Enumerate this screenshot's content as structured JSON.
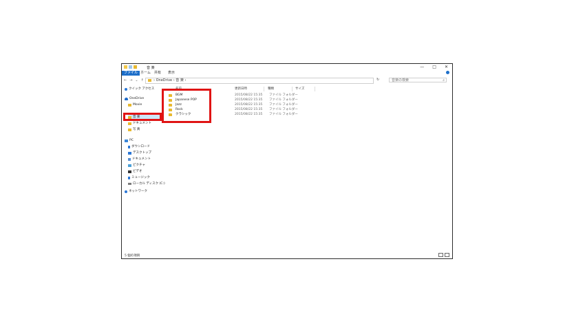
{
  "window": {
    "title": "音 楽",
    "controls": [
      "—",
      "□",
      "✕"
    ]
  },
  "ribbon": {
    "tabs": [
      "ファイル",
      "ホーム",
      "共有",
      "表示"
    ]
  },
  "address_bar": {
    "back": "←",
    "forward": "→",
    "up_history": "⌄",
    "up": "↑",
    "path": "› OneDrive › 音 楽 ›",
    "refresh": "↻",
    "search_placeholder": "音楽の検索",
    "search_icon": "⌕"
  },
  "sidebar": {
    "items": [
      {
        "label": "クイック アクセス",
        "icon": "star-icon",
        "color": "#2b77d6"
      },
      {
        "label": "OneDrive",
        "icon": "cloud-icon",
        "color": "#1f6bc8"
      },
      {
        "label": "Movie",
        "icon": "folder-icon",
        "color": "#e8b92f"
      },
      {
        "label": "音 楽",
        "icon": "folder-icon",
        "color": "#e8b92f"
      },
      {
        "label": "ドキュメント",
        "icon": "folder-icon",
        "color": "#e8b92f"
      },
      {
        "label": "写 真",
        "icon": "folder-icon",
        "color": "#e8b92f"
      },
      {
        "label": "PC",
        "icon": "pc-icon",
        "color": "#3a86d8"
      },
      {
        "label": "ダウンロード",
        "icon": "download-icon",
        "color": "#2b77d6"
      },
      {
        "label": "デスクトップ",
        "icon": "desktop-icon",
        "color": "#2b77d6"
      },
      {
        "label": "ドキュメント",
        "icon": "document-icon",
        "color": "#5a8fd0"
      },
      {
        "label": "ピクチャ",
        "icon": "picture-icon",
        "color": "#4aa0d8"
      },
      {
        "label": "ビデオ",
        "icon": "video-icon",
        "color": "#333333"
      },
      {
        "label": "ミュージック",
        "icon": "music-icon",
        "color": "#2b77d6"
      },
      {
        "label": "ローカル ディスク (C:)",
        "icon": "disk-icon",
        "color": "#7a7a7a"
      },
      {
        "label": "ネットワーク",
        "icon": "network-icon",
        "color": "#2b77d6"
      }
    ]
  },
  "columns": [
    "名前",
    "更新日時",
    "種類",
    "サイズ"
  ],
  "files": [
    {
      "name": "BGM",
      "modified": "2015/08/22 15:35",
      "type": "ファイル フォルダー"
    },
    {
      "name": "Japanese POP",
      "modified": "2015/08/22 15:35",
      "type": "ファイル フォルダー"
    },
    {
      "name": "Jazz",
      "modified": "2015/08/22 15:35",
      "type": "ファイル フォルダー"
    },
    {
      "name": "Rock",
      "modified": "2015/08/22 15:35",
      "type": "ファイル フォルダー"
    },
    {
      "name": "クラシック",
      "modified": "2015/08/22 15:35",
      "type": "ファイル フォルダー"
    }
  ],
  "status": {
    "text": "5 個の項目"
  },
  "colors": {
    "highlight": "#e01414",
    "accent": "#1e6fc9",
    "folder": "#e8b92f"
  }
}
